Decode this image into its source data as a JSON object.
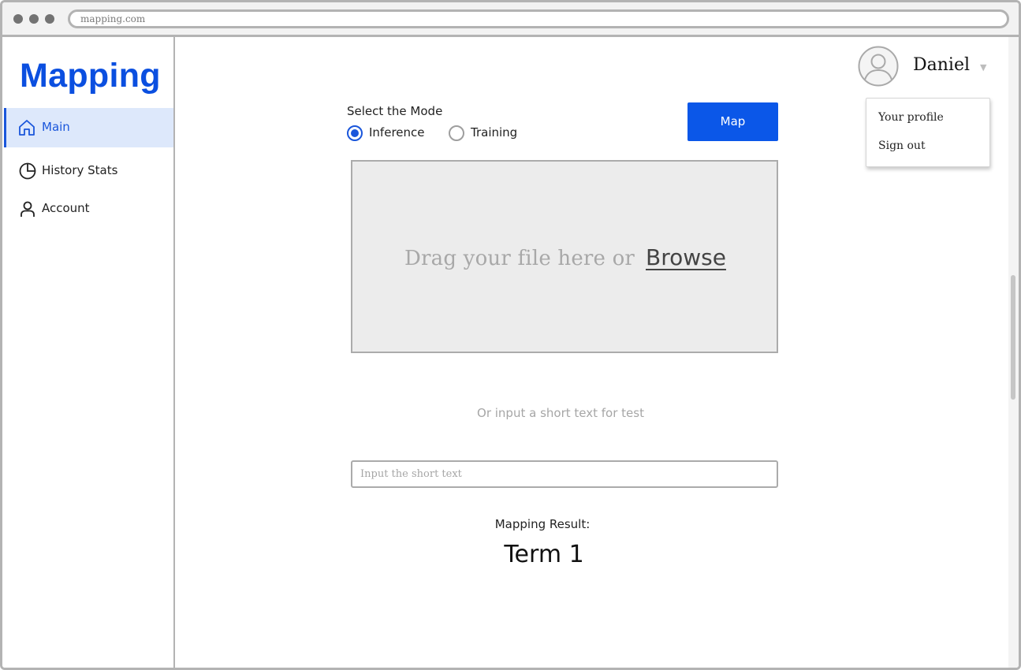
{
  "browser": {
    "url": "mapping.com"
  },
  "sidebar": {
    "brand": "Mapping",
    "items": [
      {
        "label": "Main",
        "icon": "home-icon",
        "active": true
      },
      {
        "label": "History Stats",
        "icon": "pie-chart-icon",
        "active": false
      },
      {
        "label": "Account",
        "icon": "user-icon",
        "active": false
      }
    ]
  },
  "user": {
    "name": "Daniel",
    "avatar_icon": "user-avatar-icon",
    "caret_icon": "caret-down-icon",
    "menu": [
      {
        "label": "Your profile"
      },
      {
        "label": "Sign out"
      }
    ]
  },
  "mode": {
    "title": "Select the Mode",
    "options": [
      {
        "label": "Inference",
        "checked": true
      },
      {
        "label": "Training",
        "checked": false
      }
    ]
  },
  "map_button": {
    "label": "Map"
  },
  "upload": {
    "prompt": "Drag your file here or",
    "browse_label": "Browse"
  },
  "short_text": {
    "hint": "Or input a short text for test",
    "placeholder": "Input the short text",
    "value": ""
  },
  "result": {
    "label": "Mapping Result:",
    "value": "Term 1"
  },
  "colors": {
    "accent": "#0b57e8",
    "brand": "#0b4fe0",
    "active_bg": "#dde8fb"
  }
}
